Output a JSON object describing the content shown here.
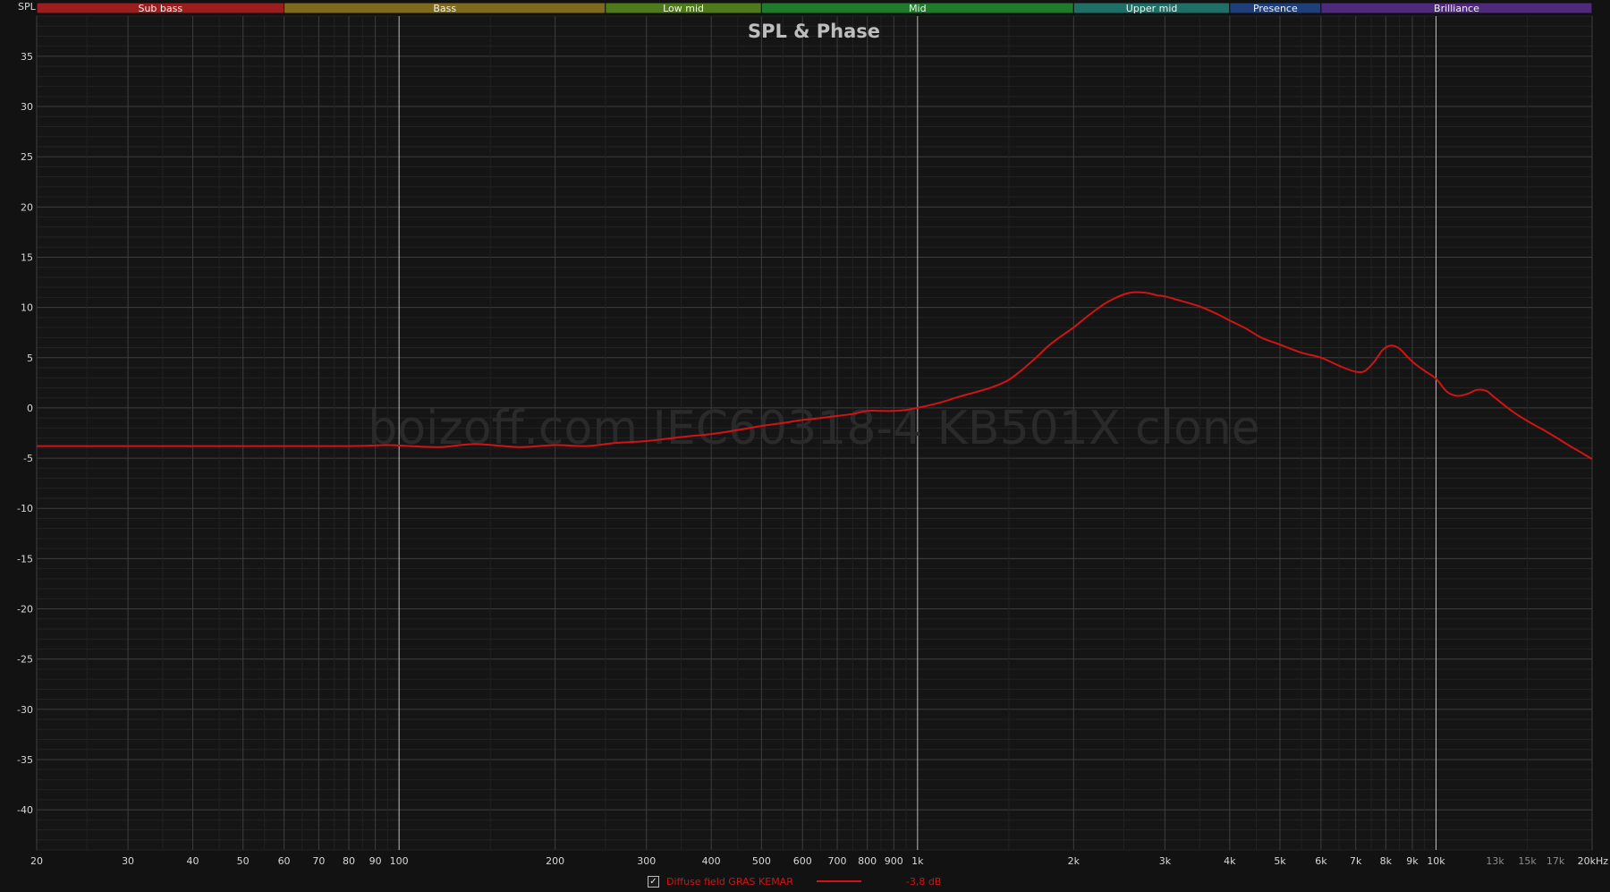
{
  "axis_label": "SPL",
  "bands": [
    {
      "label": "Sub bass",
      "from": 20,
      "to": 60,
      "color": "#9c1d1d"
    },
    {
      "label": "Bass",
      "from": 60,
      "to": 250,
      "color": "#7e6a1e"
    },
    {
      "label": "Low mid",
      "from": 250,
      "to": 500,
      "color": "#4f7a1c"
    },
    {
      "label": "Mid",
      "from": 500,
      "to": 2000,
      "color": "#1f7a2c"
    },
    {
      "label": "Upper mid",
      "from": 2000,
      "to": 4000,
      "color": "#1f6f66"
    },
    {
      "label": "Presence",
      "from": 4000,
      "to": 6000,
      "color": "#1e3f7a"
    },
    {
      "label": "Brilliance",
      "from": 6000,
      "to": 20000,
      "color": "#4f2a7c"
    }
  ],
  "watermark": "boizoff.com IEC60318-4 KB501X clone",
  "legend": {
    "label": "Diffuse field GRAS KEMAR",
    "value": "-3,8 dB",
    "checked": "✓"
  },
  "chart_data": {
    "type": "line",
    "title": "SPL & Phase",
    "xscale": "log",
    "xlim": [
      20,
      20000
    ],
    "ylim": [
      -44,
      39
    ],
    "grid": true,
    "xticks": [
      {
        "v": 20,
        "label": "20"
      },
      {
        "v": 30,
        "label": "30"
      },
      {
        "v": 40,
        "label": "40"
      },
      {
        "v": 50,
        "label": "50"
      },
      {
        "v": 60,
        "label": "60"
      },
      {
        "v": 70,
        "label": "70"
      },
      {
        "v": 80,
        "label": "80"
      },
      {
        "v": 90,
        "label": "90"
      },
      {
        "v": 100,
        "label": "100"
      },
      {
        "v": 200,
        "label": "200"
      },
      {
        "v": 300,
        "label": "300"
      },
      {
        "v": 400,
        "label": "400"
      },
      {
        "v": 500,
        "label": "500"
      },
      {
        "v": 600,
        "label": "600"
      },
      {
        "v": 700,
        "label": "700"
      },
      {
        "v": 800,
        "label": "800"
      },
      {
        "v": 900,
        "label": "900"
      },
      {
        "v": 1000,
        "label": "1k"
      },
      {
        "v": 2000,
        "label": "2k"
      },
      {
        "v": 3000,
        "label": "3k"
      },
      {
        "v": 4000,
        "label": "4k"
      },
      {
        "v": 5000,
        "label": "5k"
      },
      {
        "v": 6000,
        "label": "6k"
      },
      {
        "v": 7000,
        "label": "7k"
      },
      {
        "v": 8000,
        "label": "8k"
      },
      {
        "v": 9000,
        "label": "9k"
      },
      {
        "v": 10000,
        "label": "10k"
      },
      {
        "v": 13000,
        "label": "13k",
        "dim": true
      },
      {
        "v": 15000,
        "label": "15k",
        "dim": true
      },
      {
        "v": 17000,
        "label": "17k",
        "dim": true
      },
      {
        "v": 20000,
        "label": "20kHz"
      }
    ],
    "yticks": [
      35,
      30,
      25,
      20,
      15,
      10,
      5,
      0,
      -5,
      -10,
      -15,
      -20,
      -25,
      -30,
      -35,
      -40
    ],
    "series": [
      {
        "name": "Diffuse field GRAS KEMAR",
        "color": "#d01414",
        "x": [
          20,
          30,
          50,
          80,
          95,
          105,
          120,
          140,
          170,
          200,
          230,
          260,
          300,
          350,
          400,
          450,
          500,
          550,
          600,
          650,
          700,
          750,
          800,
          850,
          900,
          950,
          1000,
          1100,
          1200,
          1300,
          1400,
          1500,
          1600,
          1700,
          1800,
          1900,
          2000,
          2100,
          2200,
          2300,
          2400,
          2500,
          2600,
          2700,
          2800,
          2900,
          3000,
          3200,
          3500,
          3800,
          4000,
          4300,
          4600,
          5000,
          5500,
          6000,
          6500,
          7000,
          7300,
          7600,
          7900,
          8200,
          8500,
          8800,
          9100,
          9500,
          10000,
          10500,
          11000,
          11500,
          12000,
          12500,
          13000,
          14000,
          15000,
          16000,
          17000,
          18000,
          19000,
          20000
        ],
        "y": [
          -3.8,
          -3.8,
          -3.8,
          -3.8,
          -3.7,
          -3.8,
          -3.9,
          -3.6,
          -3.9,
          -3.7,
          -3.8,
          -3.5,
          -3.3,
          -2.9,
          -2.6,
          -2.2,
          -1.8,
          -1.5,
          -1.2,
          -1.0,
          -0.8,
          -0.6,
          -0.3,
          -0.3,
          -0.3,
          -0.2,
          0.0,
          0.5,
          1.1,
          1.6,
          2.1,
          2.8,
          3.9,
          5.1,
          6.3,
          7.2,
          8.0,
          8.9,
          9.7,
          10.4,
          10.9,
          11.3,
          11.5,
          11.5,
          11.4,
          11.2,
          11.1,
          10.7,
          10.1,
          9.3,
          8.7,
          7.9,
          7.0,
          6.3,
          5.5,
          5.0,
          4.2,
          3.6,
          3.7,
          4.6,
          5.8,
          6.2,
          5.9,
          5.1,
          4.4,
          3.7,
          2.9,
          1.6,
          1.2,
          1.4,
          1.8,
          1.7,
          1.0,
          -0.3,
          -1.3,
          -2.1,
          -2.9,
          -3.7,
          -4.4,
          -5.1
        ]
      }
    ]
  }
}
